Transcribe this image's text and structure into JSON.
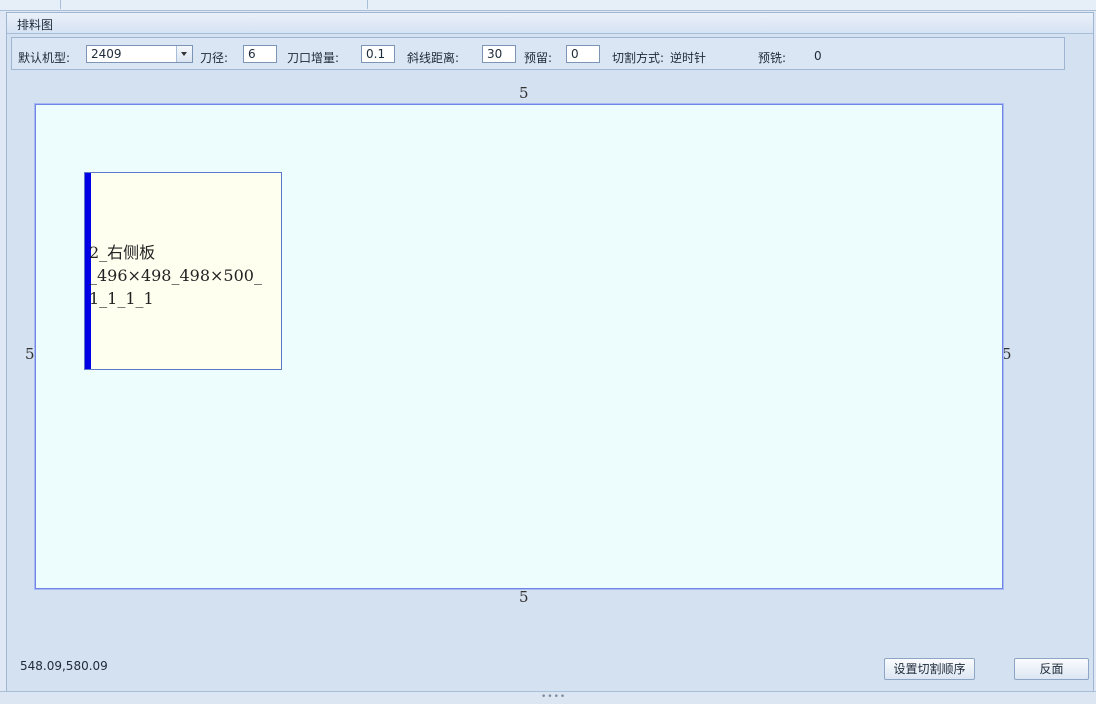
{
  "panel": {
    "title": "排料图"
  },
  "toolbar": {
    "machine_label": "默认机型:",
    "machine_value": "2409",
    "tool_dia_label": "刀径:",
    "tool_dia_value": "6",
    "kerf_inc_label": "刀口增量:",
    "kerf_inc_value": "0.1",
    "diag_dist_label": "斜线距离:",
    "diag_dist_value": "30",
    "reserve_label": "预留:",
    "reserve_value": "0",
    "cut_mode_label": "切割方式:",
    "cut_mode_value": "逆时针",
    "premill_label": "预铣:",
    "premill_value": "0"
  },
  "sheet": {
    "margin_top": "5",
    "margin_bottom": "5",
    "margin_left": "5",
    "margin_right": "5"
  },
  "part": {
    "line1": "2_右侧板",
    "line2": "_496×498_498×500_",
    "line3": "1_1_1_1",
    "fill_color": "#fffff0",
    "edge_color": "#0000e6"
  },
  "footer": {
    "coordinates": "548.09,580.09",
    "cut_order_button": "设置切割顺序",
    "flip_button": "反面"
  },
  "colors": {
    "sheet_fill": "#edfdfd",
    "sheet_border": "#6f86e6",
    "panel_bg": "#d4e1f1"
  }
}
